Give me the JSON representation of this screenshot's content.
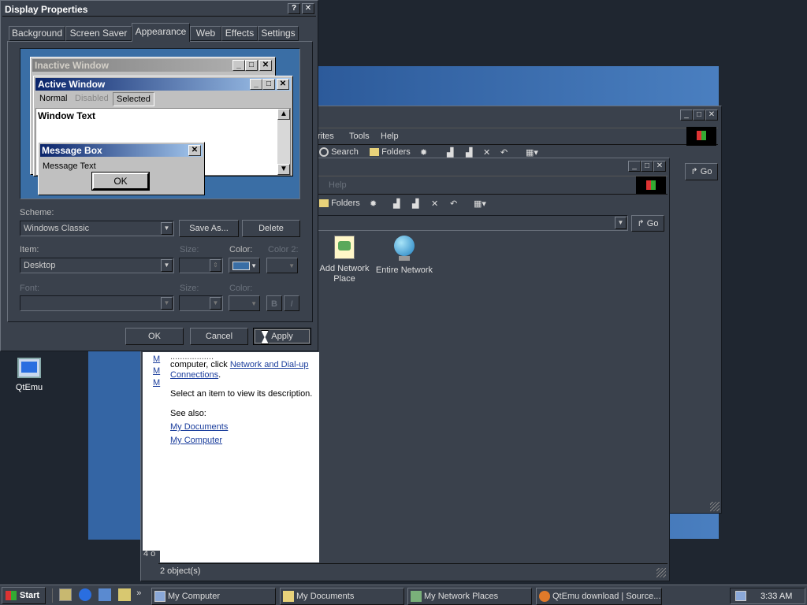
{
  "desktop": {
    "icon_label": "QtEmu"
  },
  "back_window": {
    "menu": [
      "rites",
      "Tools",
      "Help"
    ],
    "toolbar": {
      "search": "Search",
      "folders": "Folders"
    },
    "go": "Go"
  },
  "front_window": {
    "menu_help": "Help",
    "toolbar": {
      "folders": "Folders"
    },
    "go": "Go",
    "icons": [
      {
        "label": "Add Network Place"
      },
      {
        "label": "Entire Network"
      }
    ],
    "status": "2 object(s)",
    "status_left": "4 o",
    "info": {
      "text_prefix": "computer, click ",
      "link1": "Network and Dial-up Connections",
      "select_text": "Select an item to view its description.",
      "see_also": "See also:",
      "links": [
        "My Documents",
        "My Computer"
      ],
      "side_links": [
        "M",
        "M",
        "M"
      ]
    }
  },
  "dialog": {
    "title": "Display Properties",
    "tabs": [
      "Background",
      "Screen Saver",
      "Appearance",
      "Web",
      "Effects",
      "Settings"
    ],
    "preview": {
      "inactive_title": "Inactive Window",
      "active_title": "Active Window",
      "menu": [
        "Normal",
        "Disabled",
        "Selected"
      ],
      "window_text": "Window Text",
      "msgbox_title": "Message Box",
      "msgbox_text": "Message Text",
      "msgbox_ok": "OK"
    },
    "scheme_label": "Scheme:",
    "scheme_value": "Windows Classic",
    "save_as": "Save As...",
    "delete": "Delete",
    "item_label": "Item:",
    "item_value": "Desktop",
    "size_label": "Size:",
    "color_label": "Color:",
    "color2_label": "Color 2:",
    "font_label": "Font:",
    "size2_label": "Size:",
    "fcolor_label": "Color:",
    "bold": "B",
    "italic": "I",
    "ok": "OK",
    "cancel": "Cancel",
    "apply": "Apply",
    "colors": {
      "active_title": "#0a246a",
      "inactive_title": "#808080",
      "desktop_preview": "#3a6ea5",
      "selected_color": "#3a6ea5"
    }
  },
  "taskbar": {
    "start": "Start",
    "items": [
      "My Computer",
      "My Documents",
      "My Network Places",
      "QtEmu download | Source..."
    ],
    "clock": "3:33 AM"
  }
}
